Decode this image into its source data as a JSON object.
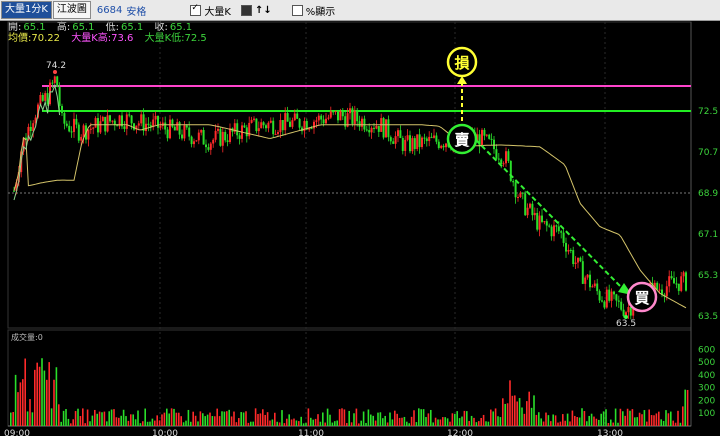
{
  "toolbar": {
    "tab_active": "大量1分K",
    "tab_other": "江波圖",
    "code": "6684",
    "name": "安格",
    "check1_label": "大量K",
    "check2_label": "↑↓",
    "check3_label": "%顯示"
  },
  "info": {
    "open_label": "開:",
    "open": "65.1",
    "high_label": "高:",
    "high": "65.1",
    "low_label": "低:",
    "low": "65.1",
    "close_label": "收:",
    "close": "65.1",
    "avg_label": "均價:",
    "avg": "70.22",
    "bigk_high_label": "大量K高:",
    "bigk_high": "73.6",
    "bigk_low_label": "大量K低:",
    "bigk_low": "72.5"
  },
  "annotations": {
    "stop": "損",
    "sell": "賣",
    "buy": "買",
    "max_label": "74.2",
    "min_label": "63.5"
  },
  "chart_data": {
    "type": "candlestick",
    "y_ticks": [
      "72.5",
      "70.7",
      "68.9",
      "67.1",
      "65.3",
      "63.5"
    ],
    "y_range": [
      63.5,
      74.2
    ],
    "ref_level": 68.9,
    "bigk_high": 73.6,
    "bigk_low": 72.5,
    "x_ticks": [
      "09:00",
      "10:00",
      "11:00",
      "12:00",
      "13:00"
    ],
    "volume_label": "成交量:0",
    "volume_ticks": [
      "600",
      "500",
      "400",
      "300",
      "200",
      "100"
    ],
    "volume_range": [
      0,
      650
    ],
    "colors": {
      "up": "#ff2a2a",
      "down": "#2adf2a",
      "avg": "#d4c46a",
      "bigk_high": "#ff44cc",
      "bigk_low": "#22ee22"
    }
  }
}
